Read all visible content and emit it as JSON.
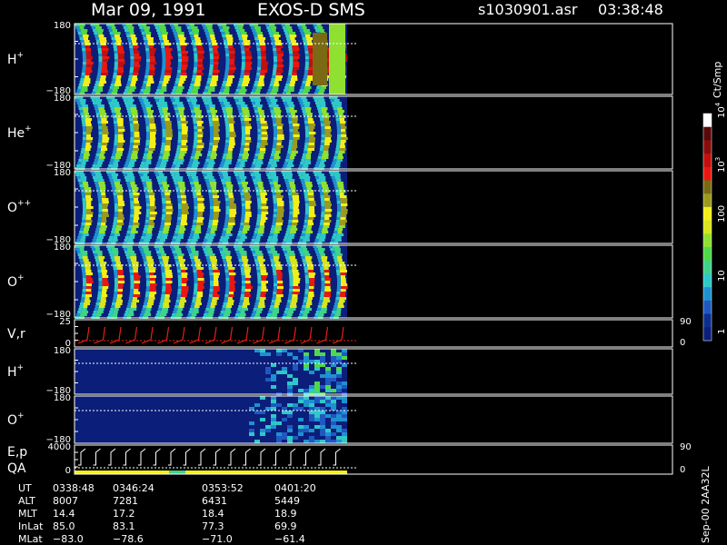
{
  "header": {
    "date": "Mar 09, 1991",
    "instrument": "EXOS-D SMS",
    "file": "s1030901.asr",
    "time": "03:38:48"
  },
  "chart_data": {
    "type": "heatmap",
    "panels": [
      {
        "id": "h-plus",
        "label": "H",
        "sup": "+",
        "y_top": "180",
        "y_bottom": "−180"
      },
      {
        "id": "he-plus",
        "label": "He",
        "sup": "+",
        "y_top": "180",
        "y_bottom": "−180"
      },
      {
        "id": "o-plusplus",
        "label": "O",
        "sup": "++",
        "y_top": "180",
        "y_bottom": "−180"
      },
      {
        "id": "o-plus",
        "label": "O",
        "sup": "+",
        "y_top": "180",
        "y_bottom": "−180"
      },
      {
        "id": "vr",
        "label": "V,r",
        "sup": "",
        "y_top": "25",
        "y_bottom": "0",
        "right_top": "90",
        "right_bottom": "0"
      },
      {
        "id": "h-plus-2",
        "label": "H",
        "sup": "+",
        "y_top": "180",
        "y_bottom": "−180"
      },
      {
        "id": "o-plus-2",
        "label": "O",
        "sup": "+",
        "y_top": "180",
        "y_bottom": "−180"
      },
      {
        "id": "ep-qa",
        "label": "E,p",
        "label2": "QA",
        "sup": "",
        "y_top": "4000",
        "y_bottom": "0",
        "right_top": "90",
        "right_bottom": "0"
      }
    ],
    "colorbar": {
      "unit": "Ct/Smp",
      "ticks": [
        {
          "label": "1",
          "exp": ""
        },
        {
          "label": "10",
          "exp": ""
        },
        {
          "label": "100",
          "exp": ""
        },
        {
          "label": "10",
          "exp": "3"
        },
        {
          "label": "10",
          "exp": "4"
        }
      ],
      "colors": [
        "#0b1e7a",
        "#0b2f8f",
        "#1f58c0",
        "#1f90d0",
        "#2fc8c8",
        "#3fd38a",
        "#4fd84a",
        "#8fe030",
        "#d8e41c",
        "#f4ee18",
        "#9c9a1c",
        "#7a6a14",
        "#e81810",
        "#c01010",
        "#8a0c0c",
        "#5a0808",
        "#ffffff"
      ]
    },
    "time_axis": {
      "rows": [
        {
          "name": "UT",
          "values": [
            "0338:48",
            "0346:24",
            "0353:52",
            "0401:20"
          ]
        },
        {
          "name": "ALT",
          "values": [
            "8007",
            "7281",
            "6431",
            "5449"
          ]
        },
        {
          "name": "MLT",
          "values": [
            "14.4",
            "17.2",
            "18.4",
            "18.9"
          ]
        },
        {
          "name": "InLat",
          "values": [
            "85.0",
            "83.1",
            "77.3",
            "69.9"
          ]
        },
        {
          "name": "MLat",
          "values": [
            "−83.0",
            "−78.6",
            "−71.0",
            "−61.4"
          ]
        }
      ]
    },
    "footer_id": "Sep-00 2AA32L"
  }
}
